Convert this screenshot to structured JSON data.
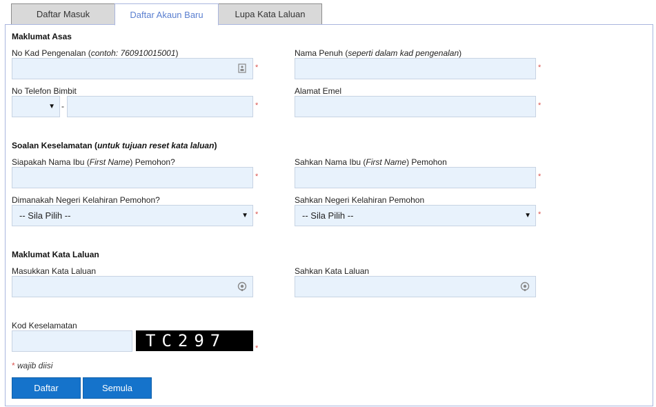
{
  "tabs": [
    {
      "label": "Daftar Masuk"
    },
    {
      "label": "Daftar Akaun Baru"
    },
    {
      "label": "Lupa Kata Laluan"
    }
  ],
  "sections": {
    "basic": "Maklumat Asas",
    "security_q_bold": "Soalan Keselamatan (",
    "security_q_italic": "untuk tujuan reset kata laluan",
    "security_q_close": ")",
    "password": "Maklumat Kata Laluan"
  },
  "labels": {
    "ic_main": "No Kad Pengenalan (",
    "ic_example": "contoh: 760910015001",
    "ic_close": ")",
    "fullname_main": "Nama Penuh (",
    "fullname_hint": "seperti dalam kad pengenalan",
    "fullname_close": ")",
    "phone": "No Telefon Bimbit",
    "phone_sep": "-",
    "email": "Alamat Emel",
    "mother_a": "Siapakah Nama Ibu (",
    "mother_i": "First Name",
    "mother_b": ") Pemohon?",
    "mother_confirm_a": "Sahkan Nama Ibu (",
    "mother_confirm_i": "First Name",
    "mother_confirm_b": ") Pemohon",
    "birthstate": "Dimanakah Negeri Kelahiran Pemohon?",
    "birthstate_confirm": "Sahkan Negeri Kelahiran Pemohon",
    "password": "Masukkan Kata Laluan",
    "password_confirm": "Sahkan Kata Laluan",
    "security_code": "Kod Keselamatan"
  },
  "selects": {
    "phone_prefix": "",
    "birthstate": "-- Sila Pilih --",
    "birthstate_confirm": "-- Sila Pilih --"
  },
  "required_mark": "*",
  "captcha_text": "TC297",
  "note_star": "*",
  "note_text": " wajib diisi",
  "buttons": {
    "submit": "Daftar",
    "reset": "Semula"
  },
  "icons": {
    "ic_field": "id-card-icon",
    "password": "eye-icon",
    "password_confirm": "eye-icon"
  }
}
